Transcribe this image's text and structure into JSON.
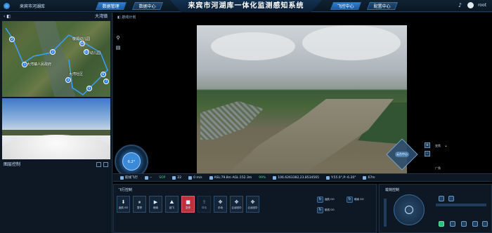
{
  "header": {
    "site_name": "来宾市河湖库",
    "title": "来宾市河湖库一体化监测感知系统",
    "tabs_left": [
      "数据管理",
      "数据中心"
    ],
    "tabs_right": [
      "飞控中心",
      "配置中心"
    ],
    "user": "root"
  },
  "left": {
    "panel_title": "大湾镇",
    "map_labels": [
      "敬源幼儿园",
      "大湾镇人民政府",
      "大湾社区",
      "幼儿园"
    ],
    "markers": [
      "2",
      "1",
      "2",
      "3",
      "4",
      "5",
      "6",
      "7",
      "8",
      "9",
      "10",
      "11",
      "14",
      "15"
    ],
    "section_title": "图层控制",
    "compass": {
      "heading": "6.2°"
    }
  },
  "main": {
    "header_label": "航线计划",
    "zoom": {
      "label_top": "变焦",
      "label_bottom": "广角",
      "plus": "+",
      "minus": "-"
    },
    "gimbal_center": "云台中心"
  },
  "status": {
    "items": [
      {
        "label": "航线飞行"
      },
      {
        "label": "--"
      },
      {
        "label": "SOP"
      },
      {
        "label": "22"
      },
      {
        "label": "0 m/s"
      },
      {
        "label": "ASL:79.8m AGL:152.3m"
      },
      {
        "label": "99%"
      },
      {
        "label": "106.6263382,23.8534565"
      },
      {
        "label": "Y:55.0°,P:-6.20°"
      },
      {
        "label": "67m"
      }
    ]
  },
  "ops": {
    "title": "飞行控制",
    "buttons": [
      {
        "icon": "⬇",
        "label": "返航 GO"
      },
      {
        "icon": "⏸",
        "label": "暂停"
      },
      {
        "icon": "▶",
        "label": "继续"
      },
      {
        "icon": "⛰",
        "label": "起飞"
      },
      {
        "icon": "■",
        "label": "急停"
      },
      {
        "icon": "⇪",
        "label": "降落"
      },
      {
        "icon": "✥",
        "label": "手动"
      },
      {
        "icon": "✥",
        "label": "云台回中"
      },
      {
        "icon": "✥",
        "label": "云台回中"
      }
    ],
    "right": [
      {
        "icon": "↻",
        "label": "返航 GO"
      },
      {
        "icon": "↻",
        "label": "继续 GO"
      },
      {
        "icon": "↻",
        "label": "航线 GO"
      }
    ]
  },
  "ptz": {
    "title": "载荷控制"
  }
}
